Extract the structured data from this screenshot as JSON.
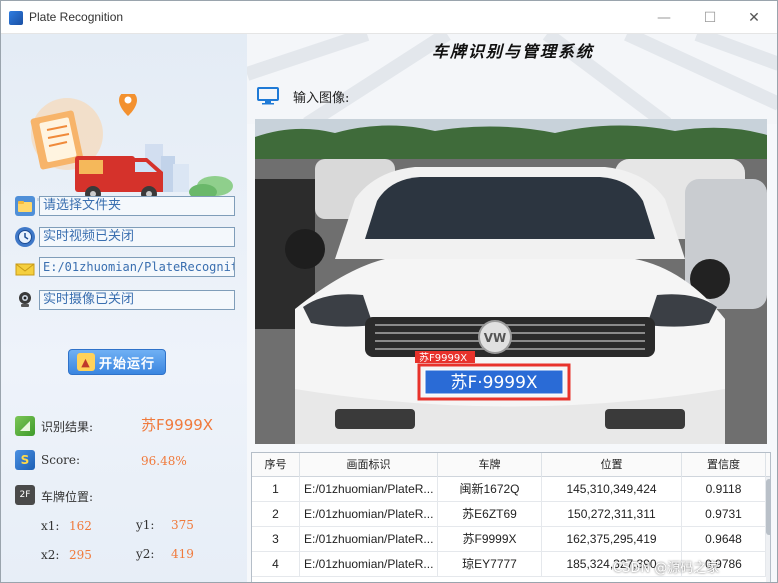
{
  "window": {
    "title": "Plate Recognition",
    "minimize": "—",
    "maximize": "☐",
    "close": "✕"
  },
  "app": {
    "heading": "车牌识别与管理系统",
    "input_label": "输入图像:"
  },
  "left": {
    "folder_field": "请选择文件夹",
    "video_field": "实时视频已关闭",
    "path_field": "E:/01zhuomian/PlateRecogniti",
    "camera_field": "实时摄像已关闭",
    "run_button": "开始运行",
    "result_label": "识别结果:",
    "result_value": "苏F9999X",
    "score_label": "Score:",
    "score_value": "96.48%",
    "position_label": "车牌位置:",
    "x1_label": "x1:",
    "x1_value": "162",
    "y1_label": "y1:",
    "y1_value": "375",
    "x2_label": "x2:",
    "x2_value": "295",
    "y2_label": "y2:",
    "y2_value": "419",
    "path_progress": 0.42
  },
  "photo": {
    "box_label": "苏F9999X",
    "plate_text": "苏F·9999X",
    "badge_text": "VW"
  },
  "table": {
    "headers": [
      "序号",
      "画面标识",
      "车牌",
      "位置",
      "置信度"
    ],
    "rows": [
      [
        "1",
        "E:/01zhuomian/PlateR...",
        "闽新1672Q",
        "145,310,349,424",
        "0.9118"
      ],
      [
        "2",
        "E:/01zhuomian/PlateR...",
        "苏E6ZT69",
        "150,272,311,311",
        "0.9731"
      ],
      [
        "3",
        "E:/01zhuomian/PlateR...",
        "苏F9999X",
        "162,375,295,419",
        "0.9648"
      ],
      [
        "4",
        "E:/01zhuomian/PlateR...",
        "琼EY7777",
        "185,324,327,390",
        "0.9786"
      ]
    ]
  },
  "watermark": "CSDN @源码之家",
  "colors": {
    "accent": "#3b86e0",
    "value": "#f07a3c",
    "box": "#e8322b",
    "plate": "#2a6bd6"
  },
  "icons": {
    "folder": "folder-open-icon",
    "video": "clock-video-icon",
    "path": "envelope-icon",
    "camera": "webcam-icon",
    "run": "rocket-icon",
    "result": "result-icon",
    "score": "score-icon",
    "position": "position-icon",
    "monitor": "monitor-icon"
  }
}
